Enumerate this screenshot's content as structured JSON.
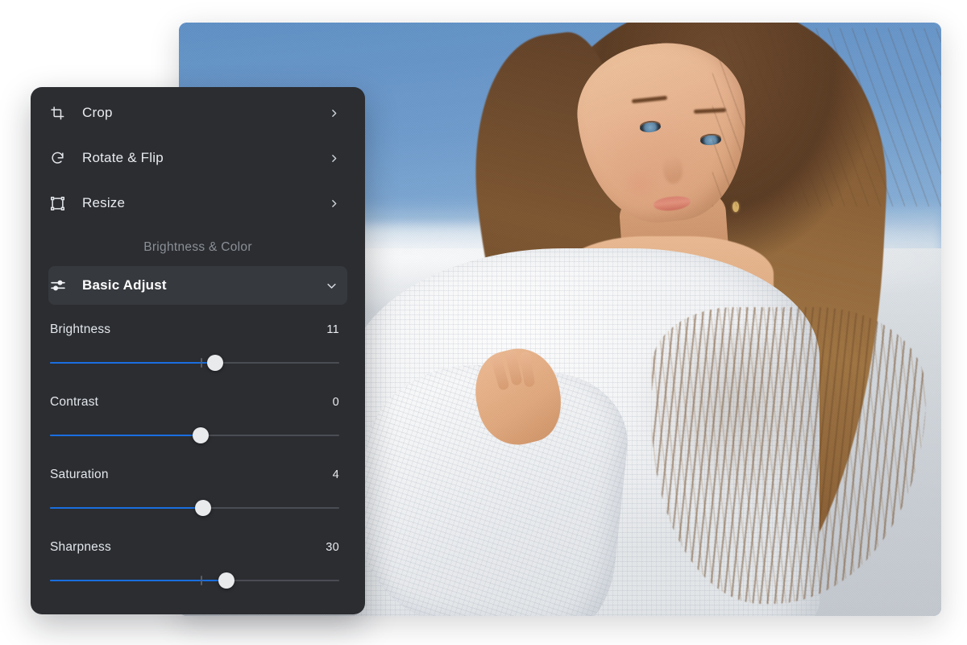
{
  "canvas": {
    "background": "#ffffff"
  },
  "photo": {
    "alt_description": "Portrait of a young woman with long brown hair in a white knit sweater against a blue sky and pale horizon",
    "sky_color": "#6f9ccd",
    "ground_color": "#cdd2d8",
    "sweater_color": "#f2f4f6",
    "hair_color": "#8a6036",
    "skin_color": "#e8b490"
  },
  "panel": {
    "background": "#2b2d31",
    "accent": "#1a6ee0",
    "menu_items": [
      {
        "label": "Crop",
        "icon": "crop-icon",
        "chevron": "chevron-right-icon"
      },
      {
        "label": "Rotate & Flip",
        "icon": "rotate-icon",
        "chevron": "chevron-right-icon"
      },
      {
        "label": "Resize",
        "icon": "resize-icon",
        "chevron": "chevron-right-icon"
      }
    ],
    "section_label": "Brightness & Color",
    "accordion": {
      "label": "Basic Adjust",
      "icon": "sliders-icon",
      "chevron": "chevron-down-icon",
      "expanded": true,
      "highlight_color": "#36393e"
    },
    "sliders": [
      {
        "name": "Brightness",
        "value": "11",
        "percent": 57,
        "tick_percent": 52,
        "has_tick": true
      },
      {
        "name": "Contrast",
        "value": "0",
        "percent": 52,
        "tick_percent": 52,
        "has_tick": false
      },
      {
        "name": "Saturation",
        "value": "4",
        "percent": 53,
        "tick_percent": 52,
        "has_tick": false
      },
      {
        "name": "Sharpness",
        "value": "30",
        "percent": 61,
        "tick_percent": 52,
        "has_tick": true
      }
    ]
  }
}
